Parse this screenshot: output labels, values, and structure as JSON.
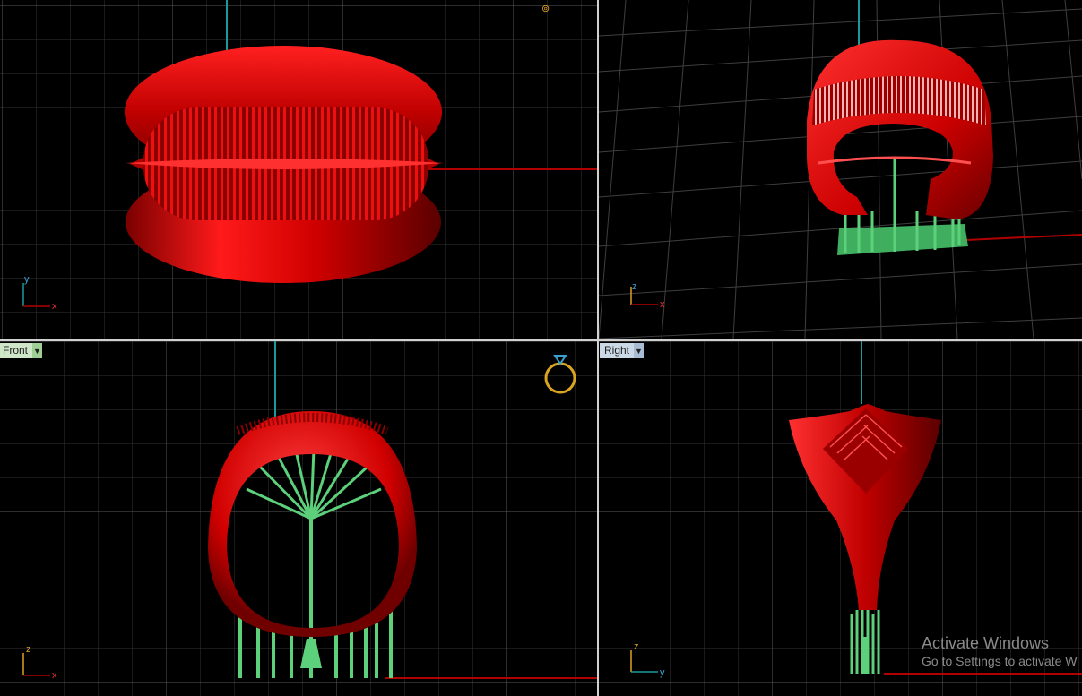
{
  "viewports": {
    "front": {
      "label": "Front"
    },
    "right": {
      "label": "Right"
    }
  },
  "axes": {
    "top": {
      "a": "y",
      "b": "x"
    },
    "persp": {
      "a": "z",
      "b": "x"
    },
    "front": {
      "a": "z",
      "b": "x"
    },
    "right": {
      "a": "z",
      "b": "y"
    }
  },
  "icons": {
    "dropdown": "chevron-down-icon",
    "gumball": "ring-gumball-icon"
  },
  "watermark": {
    "title": "Activate Windows",
    "subtitle": "Go to Settings to activate W"
  },
  "colors": {
    "model": "#e00000",
    "supports": "#3fae5f",
    "grid": "#3a3a3a",
    "x_axis": "#b00000",
    "y_axis": "#1a9a9a"
  }
}
